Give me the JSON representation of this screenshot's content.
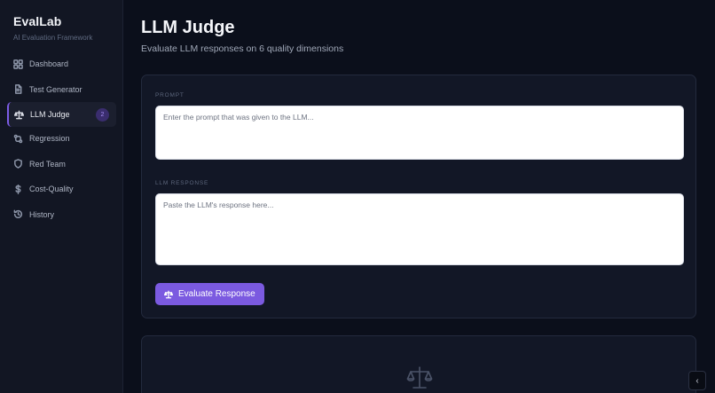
{
  "brand": {
    "title": "EvalLab",
    "subtitle": "AI Evaluation Framework"
  },
  "sidebar": {
    "items": [
      {
        "label": "Dashboard",
        "icon": "grid-icon"
      },
      {
        "label": "Test Generator",
        "icon": "file-icon"
      },
      {
        "label": "LLM Judge",
        "icon": "scale-icon",
        "active": true,
        "badge": "2"
      },
      {
        "label": "Regression",
        "icon": "git-compare-icon"
      },
      {
        "label": "Red Team",
        "icon": "shield-icon"
      },
      {
        "label": "Cost-Quality",
        "icon": "dollar-icon"
      },
      {
        "label": "History",
        "icon": "history-icon"
      }
    ]
  },
  "page": {
    "title": "LLM Judge",
    "subtitle": "Evaluate LLM responses on 6 quality dimensions"
  },
  "form": {
    "prompt_label": "PROMPT",
    "prompt_placeholder": "Enter the prompt that was given to the LLM...",
    "prompt_value": "",
    "response_label": "LLM RESPONSE",
    "response_placeholder": "Paste the LLM's response here...",
    "response_value": "",
    "submit_label": "Evaluate Response"
  },
  "corner_button": {
    "label": "‹"
  },
  "colors": {
    "accent": "#7b5ae0",
    "background": "#0b0f1b",
    "sidebar": "#121623",
    "card": "#121726"
  }
}
